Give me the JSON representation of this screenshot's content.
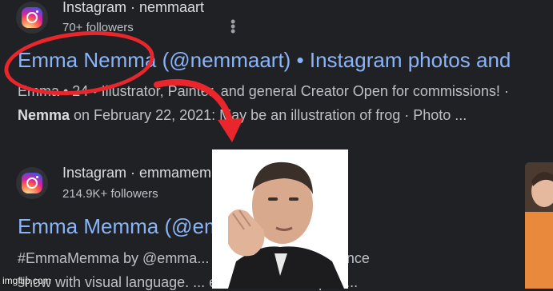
{
  "results": [
    {
      "site": "Instagram · nemmaart",
      "followers": "70+ followers",
      "title": "Emma Nemma (@nemmaart) • Instagram photos and",
      "snippet_line1": "Emma • 24 • Illustrator, Painter, and general Creator Open for commissions! ·",
      "snippet_line2_bold": "Nemma",
      "snippet_line2": " on February 22, 2021: May be an illustration of frog · Photo ..."
    },
    {
      "site": "Instagram · emmamemma",
      "followers": "214.9K+ followers",
      "title": "Emma Memma (@emmamemma)",
      "snippet_line1": "#EmmaMemma by @emma... children's musical dance",
      "snippet_line2": "show with visual language. ... emmamemma. Spotif..."
    }
  ],
  "watermark": "imgflip.com",
  "icons": {
    "favicon": "instagram-icon",
    "menu": "more-vert-icon",
    "annotation_circle": "red-circle",
    "annotation_arrow": "red-curved-arrow"
  },
  "colors": {
    "background": "#202124",
    "link": "#8ab4f8",
    "annotation": "#e8262c"
  }
}
